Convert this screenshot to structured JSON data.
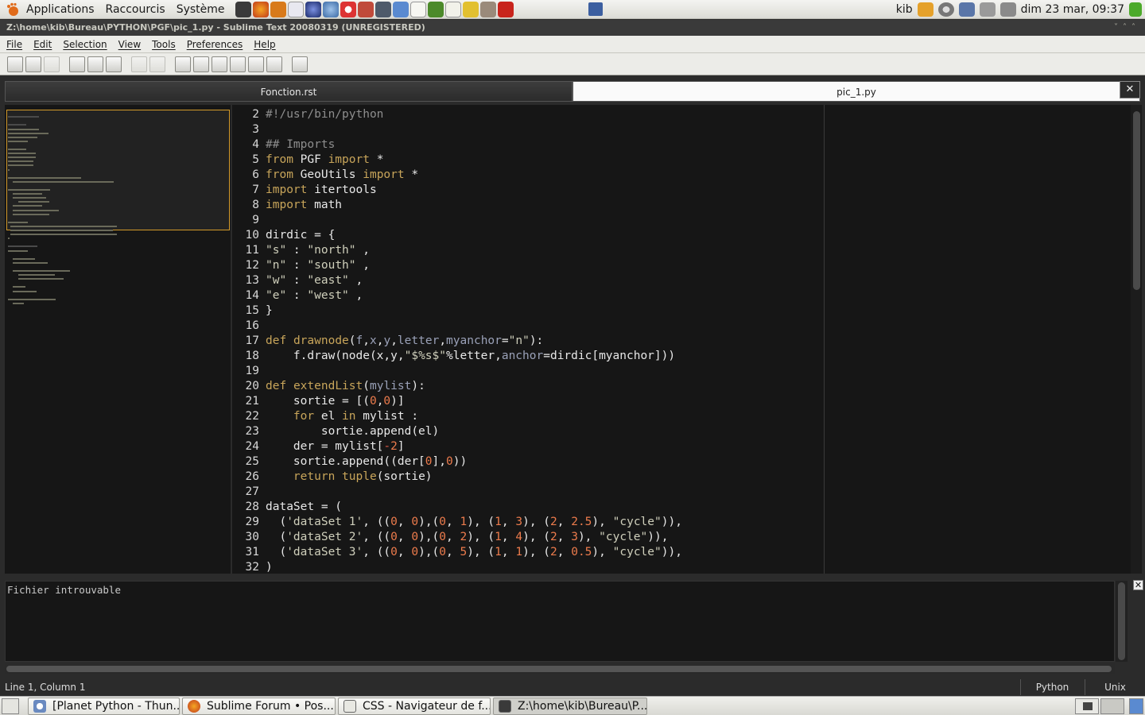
{
  "top_panel": {
    "menus": [
      "Applications",
      "Raccourcis",
      "Système"
    ],
    "user": "kib",
    "clock": "dim 23 mar, 09:37"
  },
  "window": {
    "title": "Z:\\home\\kib\\Bureau\\PYTHON\\PGF\\pic_1.py - Sublime Text 20080319 (UNREGISTERED)"
  },
  "menubar": [
    "File",
    "Edit",
    "Selection",
    "View",
    "Tools",
    "Preferences",
    "Help"
  ],
  "toolbar": {
    "buttons": [
      "new-file-icon",
      "open-file-icon",
      "save-icon",
      "cut-icon",
      "copy-icon",
      "paste-icon",
      "undo-icon",
      "redo-icon",
      "layout-single-icon",
      "layout-two-columns-icon",
      "layout-three-columns-icon",
      "layout-two-rows-icon",
      "layout-three-rows-icon",
      "layout-grid-icon",
      "fullscreen-icon"
    ]
  },
  "tabs": [
    {
      "label": "Fonction.rst",
      "active": false
    },
    {
      "label": "pic_1.py",
      "active": true
    }
  ],
  "tab_close": "✕",
  "editor": {
    "line_numbers": [
      "2",
      "3",
      "4",
      "5",
      "6",
      "7",
      "8",
      "9",
      "10",
      "11",
      "12",
      "13",
      "14",
      "15",
      "16",
      "17",
      "18",
      "19",
      "20",
      "21",
      "22",
      "23",
      "24",
      "25",
      "26",
      "27",
      "28",
      "29",
      "30",
      "31",
      "32"
    ],
    "lines": [
      "#!/usr/bin/python",
      "",
      "## Imports",
      "from PGF import *",
      "from GeoUtils import *",
      "import itertools",
      "import math",
      "",
      "dirdic = {",
      "\"s\" : \"north\" ,",
      "\"n\" : \"south\" ,",
      "\"w\" : \"east\" ,",
      "\"e\" : \"west\" ,",
      "}",
      "",
      "def drawnode(f,x,y,letter,myanchor=\"n\"):",
      "    f.draw(node(x,y,\"$%s$\"%letter,anchor=dirdic[myanchor]))",
      "",
      "def extendList(mylist):",
      "    sortie = [(0,0)]",
      "    for el in mylist :",
      "        sortie.append(el)",
      "    der = mylist[-2]",
      "    sortie.append((der[0],0))",
      "    return tuple(sortie)",
      "",
      "dataSet = (",
      "  ('dataSet 1', ((0, 0),(0, 1), (1, 3), (2, 2.5), \"cycle\")),",
      "  ('dataSet 2', ((0, 0),(0, 2), (1, 4), (2, 3), \"cycle\")),",
      "  ('dataSet 3', ((0, 0),(0, 5), (1, 1), (2, 0.5), \"cycle\")),",
      ")"
    ]
  },
  "output": {
    "text": "Fichier introuvable"
  },
  "status": {
    "position": "Line 1, Column 1",
    "syntax": "Python",
    "line_endings": "Unix"
  },
  "taskbar": {
    "tasks": [
      {
        "label": "[Planet Python - Thun...",
        "icon": "browser-icon"
      },
      {
        "label": "Sublime Forum • Pos...",
        "icon": "firefox-icon"
      },
      {
        "label": "CSS - Navigateur de f...",
        "icon": "window-icon"
      },
      {
        "label": "Z:\\home\\kib\\Bureau\\P...",
        "icon": "window-icon",
        "active": true
      }
    ]
  }
}
